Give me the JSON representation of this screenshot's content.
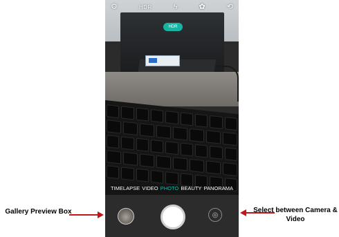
{
  "camera": {
    "top_bar": {
      "settings_icon": "gear-icon",
      "hdr_label": "HDR",
      "flash_icon": "flash-icon",
      "filter_icon": "filter-icon",
      "switch_icon": "camera-switch-icon"
    },
    "hdr_badge": "HDR",
    "modes": [
      "TIMELAPSE",
      "VIDEO",
      "PHOTO",
      "BEAUTY",
      "PANORAMA"
    ],
    "active_mode": "PHOTO",
    "controls": {
      "gallery_icon": "gallery-thumbnail",
      "shutter_icon": "shutter-button",
      "camera_video_icon": "camera-icon"
    },
    "accent_color": "#19c0b0"
  },
  "annotations": {
    "left": "Gallery Preview Box",
    "right": "Select between Camera & Video",
    "arrow_color": "#c0151b"
  }
}
